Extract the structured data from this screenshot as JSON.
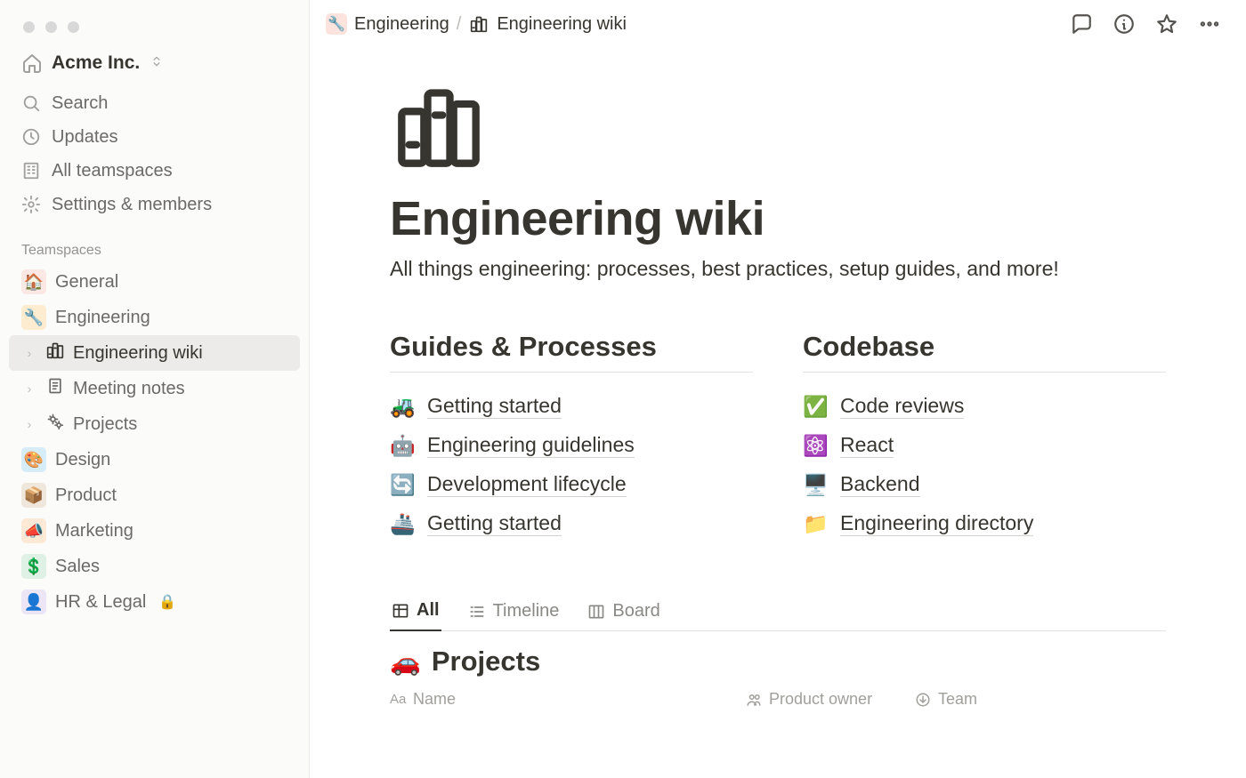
{
  "workspace": {
    "name": "Acme Inc."
  },
  "sidebar_nav": {
    "search": "Search",
    "updates": "Updates",
    "all_teamspaces": "All teamspaces",
    "settings": "Settings & members"
  },
  "section_label": "Teamspaces",
  "teamspaces": [
    {
      "emoji": "🏠",
      "label": "General",
      "bg": "#fbe7e3",
      "fg": "#e16153"
    },
    {
      "emoji": "🔧",
      "label": "Engineering",
      "bg": "#fdecd0",
      "fg": "#d68a2d",
      "children": [
        {
          "icon": "books",
          "label": "Engineering wiki",
          "active": true
        },
        {
          "icon": "note",
          "label": "Meeting notes"
        },
        {
          "icon": "gears",
          "label": "Projects"
        }
      ]
    },
    {
      "emoji": "🎨",
      "label": "Design",
      "bg": "#d6ecf8",
      "fg": "#2a84c9"
    },
    {
      "emoji": "📦",
      "label": "Product",
      "bg": "#efe7dc",
      "fg": "#aa8864"
    },
    {
      "emoji": "📣",
      "label": "Marketing",
      "bg": "#fde9d6",
      "fg": "#d77f3c"
    },
    {
      "emoji": "💲",
      "label": "Sales",
      "bg": "#def1e4",
      "fg": "#4a9f68"
    },
    {
      "emoji": "👤",
      "label": "HR & Legal",
      "bg": "#ece5f6",
      "fg": "#8a6fc2",
      "locked": true
    }
  ],
  "breadcrumb": [
    {
      "emoji": "🔧",
      "label": "Engineering",
      "bg": "#fce3de",
      "fg": "#da5b49"
    },
    {
      "icon": "books",
      "label": "Engineering wiki"
    }
  ],
  "page": {
    "title": "Engineering wiki",
    "description": "All things engineering: processes, best practices, setup guides, and more!"
  },
  "columns": [
    {
      "heading": "Guides & Processes",
      "links": [
        {
          "emoji": "🚜",
          "label": "Getting started"
        },
        {
          "emoji": "🤖",
          "label": "Engineering guidelines"
        },
        {
          "emoji": "🔄",
          "label": "Development lifecycle"
        },
        {
          "emoji": "🚢",
          "label": "Getting started"
        }
      ]
    },
    {
      "heading": "Codebase",
      "links": [
        {
          "emoji": "✅",
          "label": "Code reviews"
        },
        {
          "emoji": "⚛️",
          "label": "React"
        },
        {
          "emoji": "🖥️",
          "label": "Backend"
        },
        {
          "emoji": "📁",
          "label": "Engineering directory"
        }
      ]
    }
  ],
  "database": {
    "tabs": [
      {
        "label": "All",
        "active": true,
        "icon": "table"
      },
      {
        "label": "Timeline",
        "icon": "list"
      },
      {
        "label": "Board",
        "icon": "board"
      }
    ],
    "emoji": "🚗",
    "title": "Projects",
    "columns": [
      {
        "label": "Name",
        "icon": "Aa",
        "key": "name"
      },
      {
        "label": "Product owner",
        "icon": "person",
        "key": "owner"
      },
      {
        "label": "Team",
        "icon": "circle-down",
        "key": "team"
      }
    ]
  },
  "colors": {
    "accent": "#e5533f"
  }
}
